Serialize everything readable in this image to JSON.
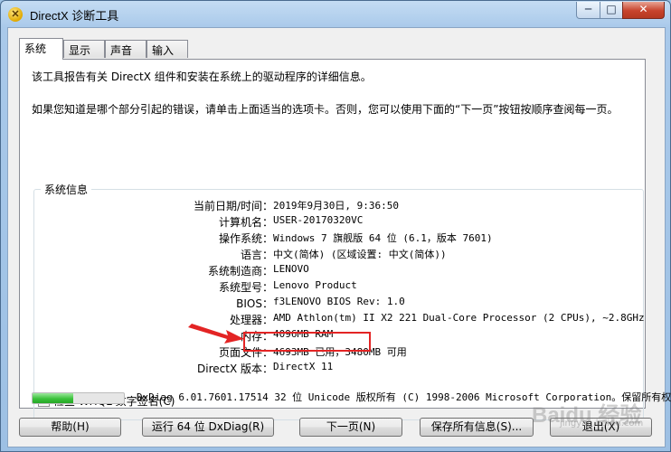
{
  "window": {
    "title": "DirectX 诊断工具",
    "icon": "directx-icon",
    "minimize_label": "─",
    "maximize_label": "□",
    "close_label": "✕"
  },
  "tabs": [
    {
      "label": "系统",
      "active": true
    },
    {
      "label": "显示",
      "active": false
    },
    {
      "label": "声音",
      "active": false
    },
    {
      "label": "输入",
      "active": false
    }
  ],
  "intro": {
    "line1": "该工具报告有关 DirectX 组件和安装在系统上的驱动程序的详细信息。",
    "line2": "如果您知道是哪个部分引起的错误，请单击上面适当的选项卡。否则，您可以使用下面的“下一页”按钮按顺序查阅每一页。"
  },
  "system_info": {
    "group_title": "系统信息",
    "rows": [
      {
        "label": "当前日期/时间：",
        "value": "2019年9月30日, 9:36:50"
      },
      {
        "label": "计算机名：",
        "value": "USER-20170320VC"
      },
      {
        "label": "操作系统：",
        "value": "Windows 7 旗舰版 64 位 (6.1，版本 7601)"
      },
      {
        "label": "语言：",
        "value": "中文(简体) (区域设置: 中文(简体))"
      },
      {
        "label": "系统制造商：",
        "value": "LENOVO"
      },
      {
        "label": "系统型号：",
        "value": "Lenovo Product"
      },
      {
        "label": "BIOS：",
        "value": "f3LENOVO BIOS Rev: 1.0"
      },
      {
        "label": "处理器：",
        "value": "AMD Athlon(tm) II X2 221 Dual-Core Processor (2 CPUs), ~2.8GHz"
      },
      {
        "label": "内存：",
        "value": "4096MB RAM"
      },
      {
        "label": "页面文件：",
        "value": "4693MB 已用，3480MB 可用"
      },
      {
        "label": "DirectX 版本：",
        "value": "DirectX 11"
      }
    ]
  },
  "whql_checkbox": {
    "label": "检查 WHQL 数字签名(C)",
    "checked": false
  },
  "progress": {
    "fraction": 0.45,
    "color": "#3bc13b"
  },
  "copyright": "DxDiag 6.01.7601.17514 32 位 Unicode 版权所有 (C) 1998-2006 Microsoft Corporation。保留所有权",
  "buttons": {
    "help": "帮助(H)",
    "run64": "运行 64 位 DxDiag(R)",
    "next": "下一页(N)",
    "save": "保存所有信息(S)...",
    "exit": "退出(X)"
  },
  "annotation": {
    "highlight_color": "#e32424",
    "arrow_color": "#e32424"
  },
  "watermark": {
    "main": "Baidu 经验",
    "sub": "jingyan.baidu.com"
  }
}
